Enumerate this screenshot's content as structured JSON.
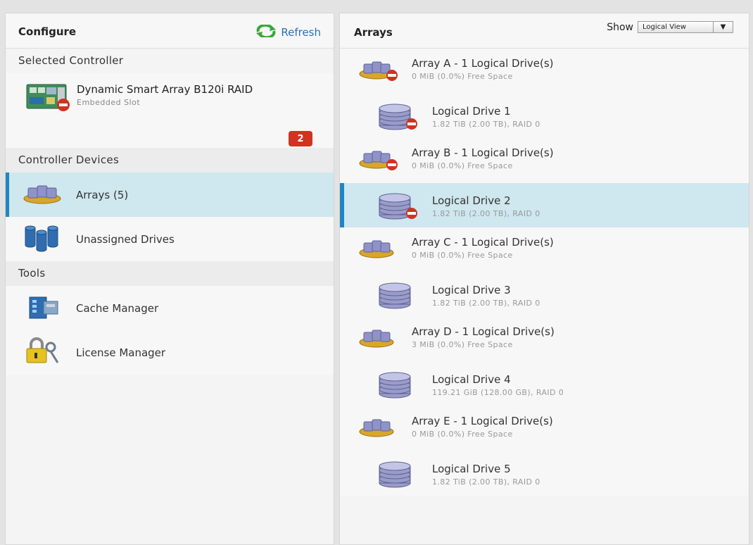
{
  "left": {
    "title": "Configure",
    "refresh_label": "Refresh",
    "selected_controller_heading": "Selected Controller",
    "controller": {
      "name": "Dynamic Smart Array B120i RAID",
      "slot": "Embedded Slot",
      "badge": "2"
    },
    "controller_devices_heading": "Controller Devices",
    "devices": [
      {
        "label": "Arrays (5)",
        "icon": "array-icon"
      },
      {
        "label": "Unassigned Drives",
        "icon": "unassigned-drives-icon"
      }
    ],
    "tools_heading": "Tools",
    "tools": [
      {
        "label": "Cache Manager",
        "icon": "cache-manager-icon"
      },
      {
        "label": "License Manager",
        "icon": "license-manager-icon"
      }
    ]
  },
  "right": {
    "title": "Arrays",
    "show_label": "Show",
    "view_select_value": "Logical View",
    "items": [
      {
        "type": "array",
        "name": "Array A - 1 Logical Drive(s)",
        "detail": "0 MiB (0.0%) Free Space",
        "error": true
      },
      {
        "type": "drive",
        "name": "Logical Drive 1",
        "detail": "1.82 TiB (2.00 TB), RAID 0",
        "error": true
      },
      {
        "type": "array",
        "name": "Array B - 1 Logical Drive(s)",
        "detail": "0 MiB (0.0%) Free Space",
        "error": true
      },
      {
        "type": "drive",
        "name": "Logical Drive 2",
        "detail": "1.82 TiB (2.00 TB), RAID 0",
        "error": true,
        "selected": true
      },
      {
        "type": "array",
        "name": "Array C - 1 Logical Drive(s)",
        "detail": "0 MiB (0.0%) Free Space",
        "error": false
      },
      {
        "type": "drive",
        "name": "Logical Drive 3",
        "detail": "1.82 TiB (2.00 TB), RAID 0",
        "error": false
      },
      {
        "type": "array",
        "name": "Array D - 1 Logical Drive(s)",
        "detail": "3 MiB (0.0%) Free Space",
        "error": false
      },
      {
        "type": "drive",
        "name": "Logical Drive 4",
        "detail": "119.21 GiB (128.00 GB), RAID 0",
        "error": false
      },
      {
        "type": "array",
        "name": "Array E - 1 Logical Drive(s)",
        "detail": "0 MiB (0.0%) Free Space",
        "error": false
      },
      {
        "type": "drive",
        "name": "Logical Drive 5",
        "detail": "1.82 TiB (2.00 TB), RAID 0",
        "error": false
      }
    ]
  },
  "colors": {
    "accent": "#1f86c2",
    "selected_bg": "#cfe7ee",
    "link": "#2b6fb6",
    "badge": "#d0331f",
    "error": "#d0331f"
  }
}
